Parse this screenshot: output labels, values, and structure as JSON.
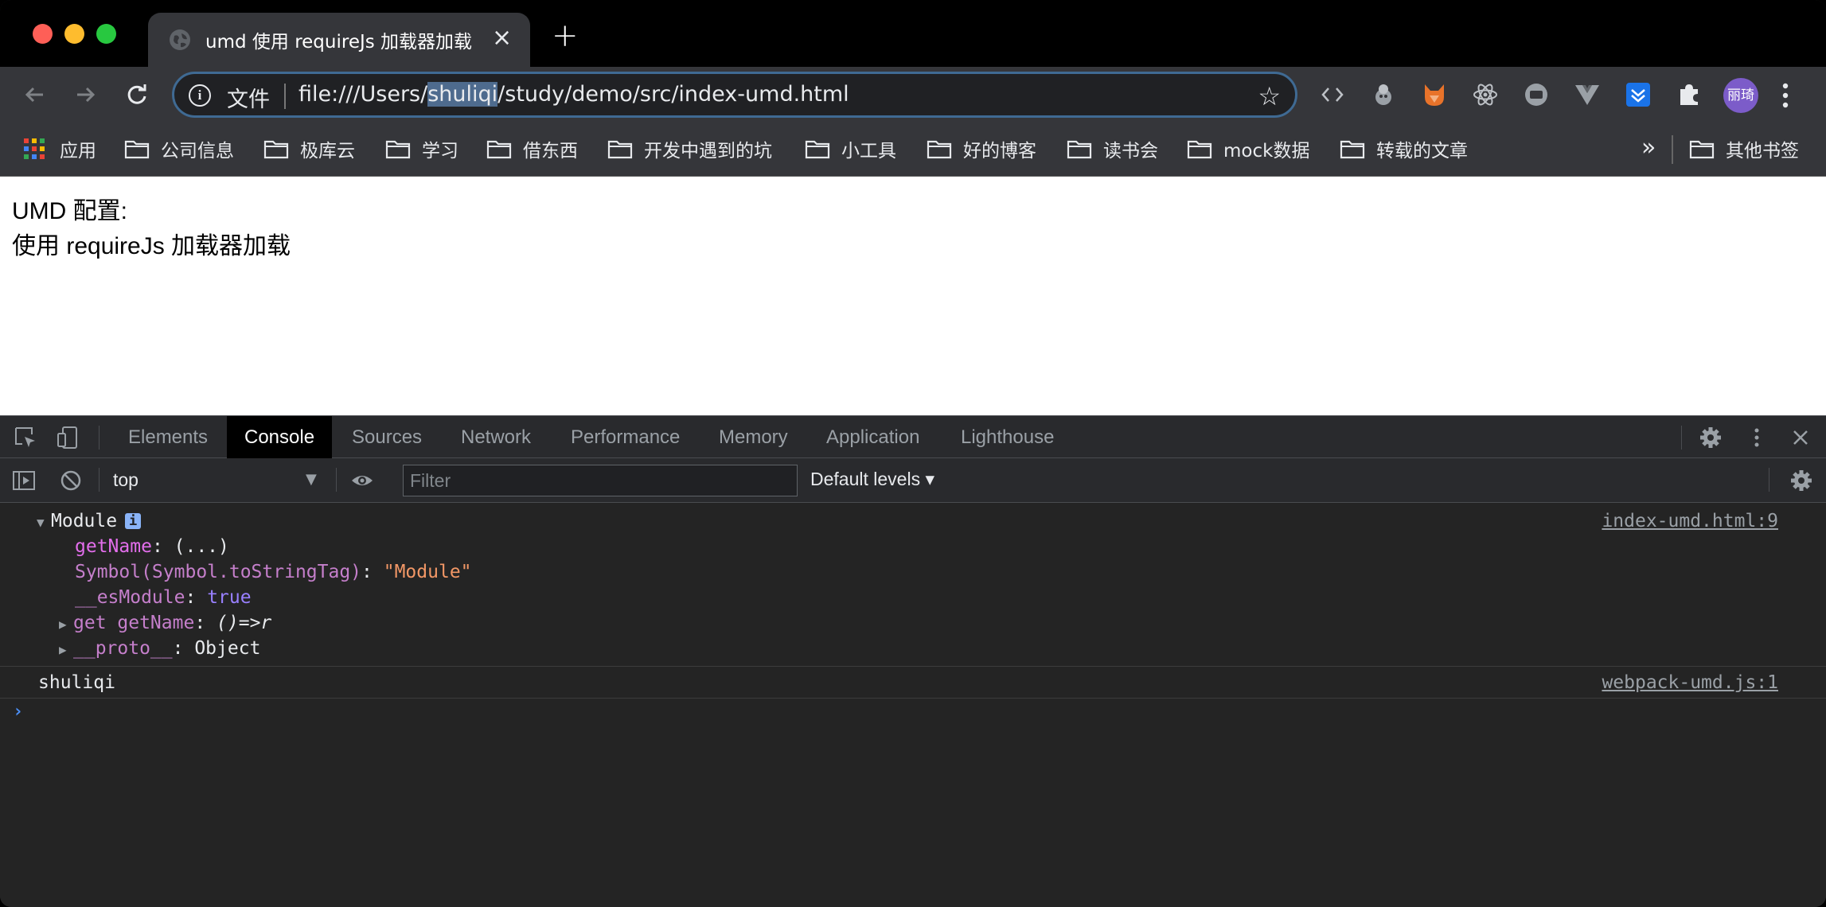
{
  "tab": {
    "title": "umd 使用 requireJs 加载器加载",
    "close_glyph": "×",
    "new_tab_glyph": "+"
  },
  "omnibox": {
    "scheme_label": "文件",
    "url_prefix": "file:///Users/",
    "url_highlight": "shuliqi",
    "url_suffix": "/study/demo/src/index-umd.html",
    "star_glyph": "☆"
  },
  "profile": {
    "initials": "丽琦"
  },
  "bookmarks": {
    "apps_label": "应用",
    "items": [
      {
        "label": "公司信息"
      },
      {
        "label": "极库云"
      },
      {
        "label": "学习"
      },
      {
        "label": "借东西"
      },
      {
        "label": "开发中遇到的坑"
      },
      {
        "label": "小工具"
      },
      {
        "label": "好的博客"
      },
      {
        "label": "读书会"
      },
      {
        "label": "mock数据"
      },
      {
        "label": "转载的文章"
      }
    ],
    "overflow_glyph": "»",
    "other_label": "其他书签"
  },
  "page": {
    "line1": "UMD 配置:",
    "line2": "使用 requireJs 加载器加载"
  },
  "devtools": {
    "tabs": [
      {
        "label": "Elements"
      },
      {
        "label": "Console",
        "active": true
      },
      {
        "label": "Sources"
      },
      {
        "label": "Network"
      },
      {
        "label": "Performance"
      },
      {
        "label": "Memory"
      },
      {
        "label": "Application"
      },
      {
        "label": "Lighthouse"
      }
    ],
    "context": "top",
    "filter_placeholder": "Filter",
    "levels_label": "Default levels ▾"
  },
  "console": {
    "entries": [
      {
        "object_label": "Module",
        "source": "index-umd.html:9",
        "props": [
          {
            "key": "getName",
            "sep": ": ",
            "value": "(...)"
          },
          {
            "key": "Symbol(Symbol.toStringTag)",
            "sep": ": ",
            "value": "\"Module\""
          },
          {
            "key": "__esModule",
            "sep": ": ",
            "value": "true"
          },
          {
            "key": "get getName",
            "sep": ": ",
            "value": "()=>r"
          },
          {
            "key": "__proto__",
            "sep": ": ",
            "value": "Object"
          }
        ]
      },
      {
        "text": "shuliqi",
        "source": "webpack-umd.js:1"
      }
    ],
    "prompt_glyph": "›"
  },
  "colors": {
    "accent_blue": "#8ab4f8",
    "string_orange": "#f29766",
    "key_purple": "#e36eec",
    "boolean_violet": "#9980ff"
  }
}
